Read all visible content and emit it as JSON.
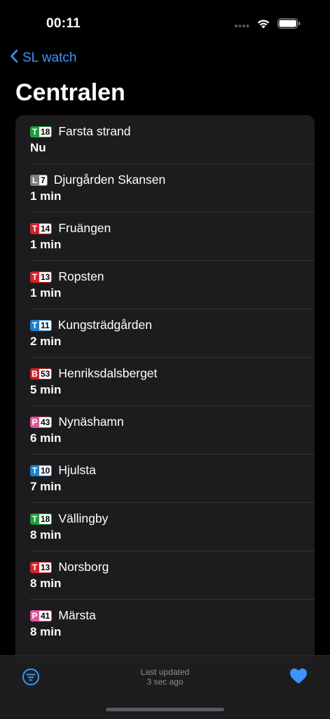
{
  "status": {
    "time": "00:11"
  },
  "nav": {
    "back_label": "SL watch"
  },
  "title": "Centralen",
  "departures": [
    {
      "mode": "T",
      "line": "18",
      "color": "#1f9e3c",
      "destination": "Farsta strand",
      "eta": "Nu"
    },
    {
      "mode": "L",
      "line": "7",
      "color": "#7e7e7e",
      "destination": "Djurgården Skansen",
      "eta": "1 min"
    },
    {
      "mode": "T",
      "line": "14",
      "color": "#d4232c",
      "destination": "Fruängen",
      "eta": "1 min"
    },
    {
      "mode": "T",
      "line": "13",
      "color": "#d4232c",
      "destination": "Ropsten",
      "eta": "1 min"
    },
    {
      "mode": "T",
      "line": "11",
      "color": "#1d7fc8",
      "destination": "Kungsträdgården",
      "eta": "2 min"
    },
    {
      "mode": "B",
      "line": "53",
      "color": "#d4232c",
      "destination": "Henriksdalsberget",
      "eta": "5 min"
    },
    {
      "mode": "P",
      "line": "43",
      "color": "#e0579a",
      "destination": "Nynäshamn",
      "eta": "6 min"
    },
    {
      "mode": "T",
      "line": "10",
      "color": "#1d7fc8",
      "destination": "Hjulsta",
      "eta": "7 min"
    },
    {
      "mode": "T",
      "line": "18",
      "color": "#1f9e3c",
      "destination": "Vällingby",
      "eta": "8 min"
    },
    {
      "mode": "T",
      "line": "13",
      "color": "#d4232c",
      "destination": "Norsborg",
      "eta": "8 min"
    },
    {
      "mode": "P",
      "line": "41",
      "color": "#e0579a",
      "destination": "Märsta",
      "eta": "8 min"
    }
  ],
  "footer": {
    "updated_label": "Last updated",
    "updated_value": "3 sec ago"
  },
  "icons": {
    "back": "chevron-left-icon",
    "filter": "filter-icon",
    "favorite": "heart-icon"
  },
  "colors": {
    "accent": "#3a95ff",
    "list_bg": "#1c1c1e"
  }
}
